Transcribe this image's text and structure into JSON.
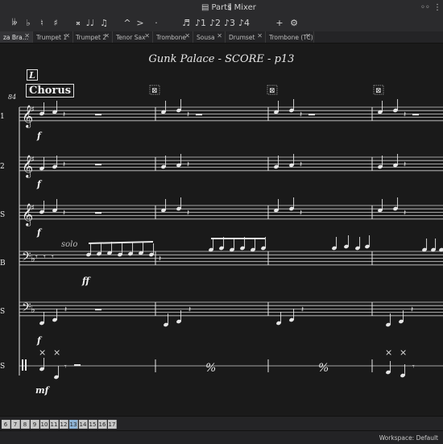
{
  "titlebar": {
    "parts_label": "Parts",
    "mixer_label": "Mixer"
  },
  "toolbar": {
    "tools": [
      {
        "name": "double-flat-icon",
        "glyph": "𝄫"
      },
      {
        "name": "flat-icon",
        "glyph": "♭"
      },
      {
        "name": "natural-icon",
        "glyph": "♮"
      },
      {
        "name": "sharp-icon",
        "glyph": "♯"
      },
      {
        "name": "double-sharp-icon",
        "glyph": "𝄪"
      },
      {
        "name": "tie-icon",
        "glyph": "♩♩"
      },
      {
        "name": "grace-note-icon",
        "glyph": "♫"
      },
      {
        "name": "marcato-icon",
        "glyph": "^"
      },
      {
        "name": "accent-icon",
        "glyph": ">"
      },
      {
        "name": "staccato-icon",
        "glyph": "·"
      },
      {
        "name": "tuplet-icon",
        "glyph": "♬"
      },
      {
        "name": "duration-1-icon",
        "glyph": "♪1"
      },
      {
        "name": "duration-2-icon",
        "glyph": "♪2"
      },
      {
        "name": "duration-3-icon",
        "glyph": "♪3"
      },
      {
        "name": "duration-4-icon",
        "glyph": "♪4"
      },
      {
        "name": "add-icon",
        "glyph": "+"
      },
      {
        "name": "settings-icon",
        "glyph": "⚙"
      }
    ]
  },
  "tabs": [
    {
      "label": "za Bra…",
      "active": true
    },
    {
      "label": "Trumpet 1"
    },
    {
      "label": "Trumpet 2"
    },
    {
      "label": "Tenor Sax"
    },
    {
      "label": "Trombone"
    },
    {
      "label": "Sousa"
    },
    {
      "label": "Drumset"
    },
    {
      "label": "Trombone (TC)"
    }
  ],
  "score": {
    "title": "Gunk Palace - SCORE - p13",
    "rehearsal_letter": "L",
    "section_text": "Chorus",
    "measure_number": "84",
    "solo_text": "solo",
    "staff_labels": [
      "1",
      "2",
      "S",
      "B",
      "S",
      "S"
    ],
    "dynamics": [
      "f",
      "f",
      "f",
      "ff",
      "f",
      "mf"
    ],
    "repeat_sign": "𝄎"
  },
  "pagebar": {
    "pages": [
      "6",
      "7",
      "8",
      "9",
      "10",
      "11",
      "12",
      "13",
      "14",
      "15",
      "16",
      "17"
    ],
    "active_page": "13"
  },
  "status": {
    "workspace": "Workspace: Default"
  }
}
